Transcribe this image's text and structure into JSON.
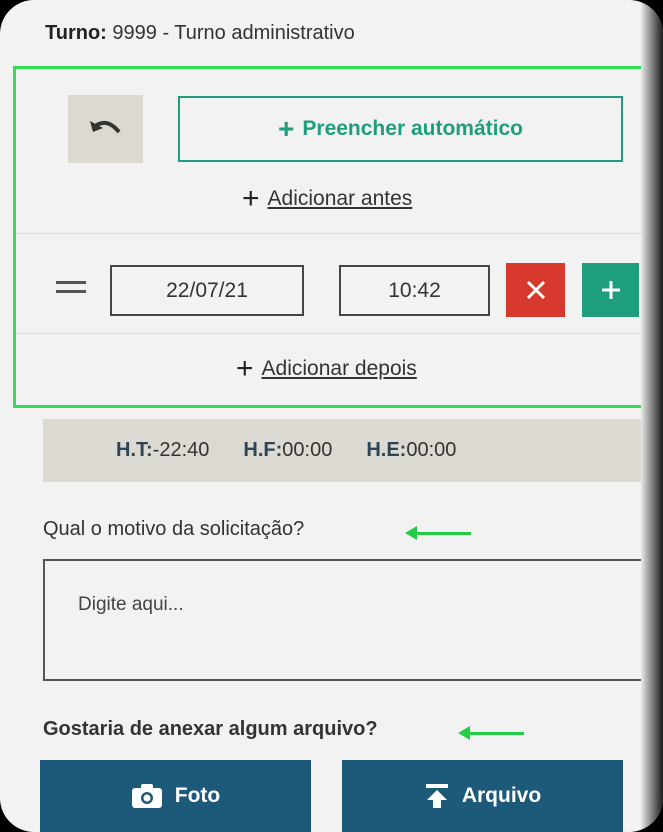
{
  "shift": {
    "label": "Turno:",
    "value": "9999 - Turno administrativo"
  },
  "entry_panel": {
    "auto_fill_label": "Preencher automático",
    "add_before_label": "Adicionar antes",
    "add_after_label": "Adicionar depois",
    "date": "22/07/21",
    "time": "10:42"
  },
  "totals": [
    {
      "label": "H.T:",
      "value": "-22:40"
    },
    {
      "label": "H.F:",
      "value": "00:00"
    },
    {
      "label": "H.E:",
      "value": "00:00"
    }
  ],
  "reason": {
    "question": "Qual o motivo da solicitação?",
    "placeholder": "Digite aqui..."
  },
  "attachment": {
    "question": "Gostaria de anexar algum arquivo?",
    "photo_label": "Foto",
    "file_label": "Arquivo"
  },
  "colors": {
    "accent_green": "#1f9e7e",
    "delete_red": "#d7392f",
    "button_blue": "#1d5a7a",
    "highlight_green": "#33dd55"
  }
}
